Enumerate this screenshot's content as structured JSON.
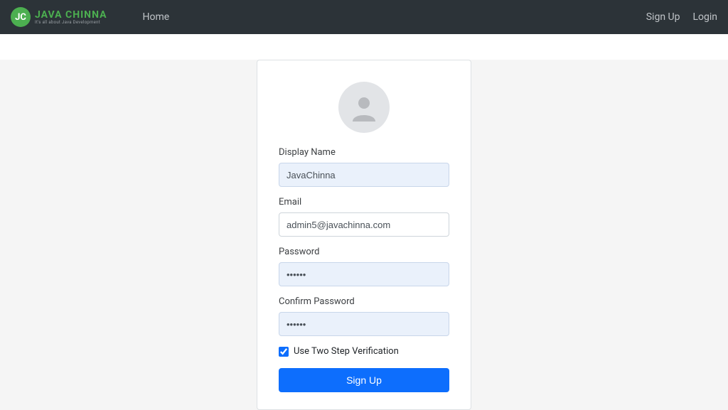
{
  "brand": {
    "badge": "JC",
    "name": "JAVA CHINNA",
    "tagline": "It's all about Java Development"
  },
  "nav": {
    "home": "Home",
    "signup": "Sign Up",
    "login": "Login"
  },
  "form": {
    "display_name_label": "Display Name",
    "display_name_value": "JavaChinna",
    "email_label": "Email",
    "email_value": "admin5@javachinna.com",
    "password_label": "Password",
    "password_value": "••••••",
    "confirm_password_label": "Confirm Password",
    "confirm_password_value": "••••••",
    "two_step_label": "Use Two Step Verification",
    "two_step_checked": true,
    "submit_label": "Sign Up"
  }
}
